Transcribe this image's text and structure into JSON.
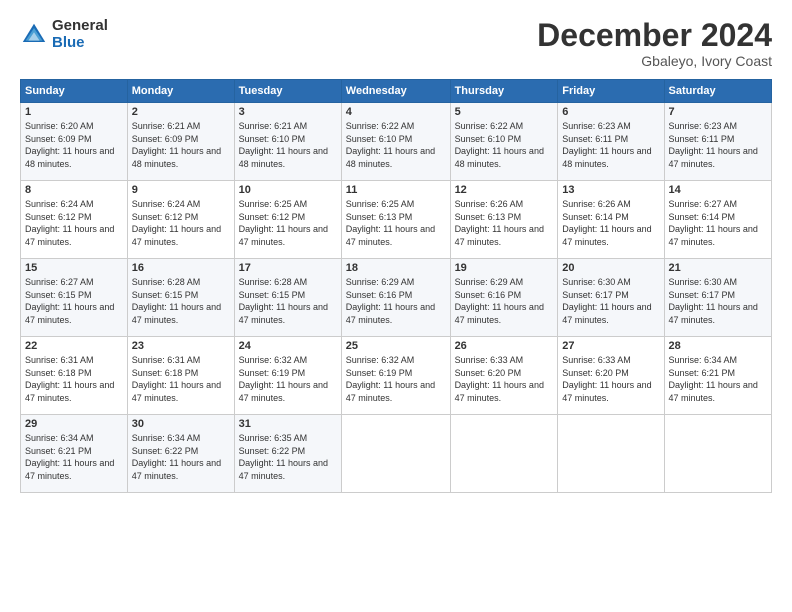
{
  "header": {
    "logo_general": "General",
    "logo_blue": "Blue",
    "month_year": "December 2024",
    "location": "Gbaleyo, Ivory Coast"
  },
  "days_of_week": [
    "Sunday",
    "Monday",
    "Tuesday",
    "Wednesday",
    "Thursday",
    "Friday",
    "Saturday"
  ],
  "weeks": [
    [
      {
        "day": "1",
        "sunrise": "6:20 AM",
        "sunset": "6:09 PM",
        "daylight": "11 hours and 48 minutes."
      },
      {
        "day": "2",
        "sunrise": "6:21 AM",
        "sunset": "6:09 PM",
        "daylight": "11 hours and 48 minutes."
      },
      {
        "day": "3",
        "sunrise": "6:21 AM",
        "sunset": "6:10 PM",
        "daylight": "11 hours and 48 minutes."
      },
      {
        "day": "4",
        "sunrise": "6:22 AM",
        "sunset": "6:10 PM",
        "daylight": "11 hours and 48 minutes."
      },
      {
        "day": "5",
        "sunrise": "6:22 AM",
        "sunset": "6:10 PM",
        "daylight": "11 hours and 48 minutes."
      },
      {
        "day": "6",
        "sunrise": "6:23 AM",
        "sunset": "6:11 PM",
        "daylight": "11 hours and 48 minutes."
      },
      {
        "day": "7",
        "sunrise": "6:23 AM",
        "sunset": "6:11 PM",
        "daylight": "11 hours and 47 minutes."
      }
    ],
    [
      {
        "day": "8",
        "sunrise": "6:24 AM",
        "sunset": "6:12 PM",
        "daylight": "11 hours and 47 minutes."
      },
      {
        "day": "9",
        "sunrise": "6:24 AM",
        "sunset": "6:12 PM",
        "daylight": "11 hours and 47 minutes."
      },
      {
        "day": "10",
        "sunrise": "6:25 AM",
        "sunset": "6:12 PM",
        "daylight": "11 hours and 47 minutes."
      },
      {
        "day": "11",
        "sunrise": "6:25 AM",
        "sunset": "6:13 PM",
        "daylight": "11 hours and 47 minutes."
      },
      {
        "day": "12",
        "sunrise": "6:26 AM",
        "sunset": "6:13 PM",
        "daylight": "11 hours and 47 minutes."
      },
      {
        "day": "13",
        "sunrise": "6:26 AM",
        "sunset": "6:14 PM",
        "daylight": "11 hours and 47 minutes."
      },
      {
        "day": "14",
        "sunrise": "6:27 AM",
        "sunset": "6:14 PM",
        "daylight": "11 hours and 47 minutes."
      }
    ],
    [
      {
        "day": "15",
        "sunrise": "6:27 AM",
        "sunset": "6:15 PM",
        "daylight": "11 hours and 47 minutes."
      },
      {
        "day": "16",
        "sunrise": "6:28 AM",
        "sunset": "6:15 PM",
        "daylight": "11 hours and 47 minutes."
      },
      {
        "day": "17",
        "sunrise": "6:28 AM",
        "sunset": "6:15 PM",
        "daylight": "11 hours and 47 minutes."
      },
      {
        "day": "18",
        "sunrise": "6:29 AM",
        "sunset": "6:16 PM",
        "daylight": "11 hours and 47 minutes."
      },
      {
        "day": "19",
        "sunrise": "6:29 AM",
        "sunset": "6:16 PM",
        "daylight": "11 hours and 47 minutes."
      },
      {
        "day": "20",
        "sunrise": "6:30 AM",
        "sunset": "6:17 PM",
        "daylight": "11 hours and 47 minutes."
      },
      {
        "day": "21",
        "sunrise": "6:30 AM",
        "sunset": "6:17 PM",
        "daylight": "11 hours and 47 minutes."
      }
    ],
    [
      {
        "day": "22",
        "sunrise": "6:31 AM",
        "sunset": "6:18 PM",
        "daylight": "11 hours and 47 minutes."
      },
      {
        "day": "23",
        "sunrise": "6:31 AM",
        "sunset": "6:18 PM",
        "daylight": "11 hours and 47 minutes."
      },
      {
        "day": "24",
        "sunrise": "6:32 AM",
        "sunset": "6:19 PM",
        "daylight": "11 hours and 47 minutes."
      },
      {
        "day": "25",
        "sunrise": "6:32 AM",
        "sunset": "6:19 PM",
        "daylight": "11 hours and 47 minutes."
      },
      {
        "day": "26",
        "sunrise": "6:33 AM",
        "sunset": "6:20 PM",
        "daylight": "11 hours and 47 minutes."
      },
      {
        "day": "27",
        "sunrise": "6:33 AM",
        "sunset": "6:20 PM",
        "daylight": "11 hours and 47 minutes."
      },
      {
        "day": "28",
        "sunrise": "6:34 AM",
        "sunset": "6:21 PM",
        "daylight": "11 hours and 47 minutes."
      }
    ],
    [
      {
        "day": "29",
        "sunrise": "6:34 AM",
        "sunset": "6:21 PM",
        "daylight": "11 hours and 47 minutes."
      },
      {
        "day": "30",
        "sunrise": "6:34 AM",
        "sunset": "6:22 PM",
        "daylight": "11 hours and 47 minutes."
      },
      {
        "day": "31",
        "sunrise": "6:35 AM",
        "sunset": "6:22 PM",
        "daylight": "11 hours and 47 minutes."
      },
      null,
      null,
      null,
      null
    ]
  ],
  "labels": {
    "sunrise": "Sunrise:",
    "sunset": "Sunset:",
    "daylight": "Daylight:"
  }
}
